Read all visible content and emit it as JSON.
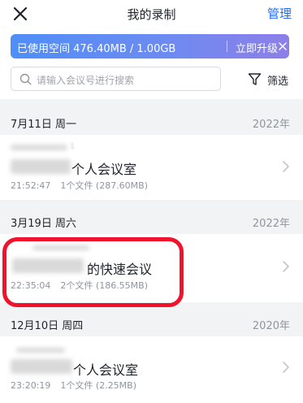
{
  "header": {
    "title": "我的录制",
    "manage_label": "管理"
  },
  "storage": {
    "used_text": "已使用空间 476.40MB / 1.00GB",
    "upgrade_label": "立即升级",
    "used_fraction": 0.465
  },
  "search": {
    "placeholder": "请输入会议号进行搜索",
    "filter_label": "筛选"
  },
  "groups": [
    {
      "date": "7月11日 周一",
      "year": "2022年",
      "row": {
        "meeting_id": "1",
        "name": "个人会议室",
        "time": "21:52:47",
        "files": "1个文件 (287.60MB)"
      }
    },
    {
      "date": "3月19日 周六",
      "year": "2022年",
      "row": {
        "name": "的快速会议",
        "time": "22:35:04",
        "files": "2个文件 (186.55MB)"
      }
    },
    {
      "date": "12月10日 周四",
      "year": "2020年",
      "row": {
        "name": "个人会议室",
        "time": "23:20:19",
        "files": "1个文件 (2.25MB)"
      }
    }
  ],
  "colors": {
    "accent": "#2a6cf0",
    "highlight": "#f0132b"
  },
  "icons": [
    "close-icon",
    "search-icon",
    "filter-icon",
    "chevron-right-icon"
  ]
}
